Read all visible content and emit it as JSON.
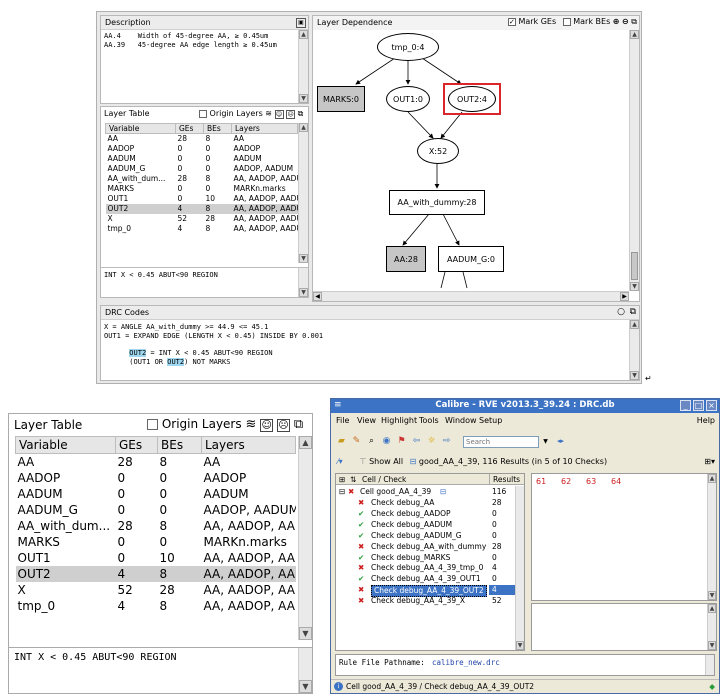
{
  "top": {
    "description": {
      "title": "Description",
      "lines": [
        "AA.4    Width of 45-degree AA, ≥ 0.45um",
        "AA.39   45-degree AA edge length ≥ 0.45um"
      ]
    },
    "layer_table": {
      "title": "Layer Table",
      "origin_layers": "Origin Layers",
      "columns": [
        "Variable",
        "GEs",
        "BEs",
        "Layers"
      ],
      "rows": [
        [
          "AA",
          "28",
          "8",
          "AA"
        ],
        [
          "AADOP",
          "0",
          "0",
          "AADOP"
        ],
        [
          "AADUM",
          "0",
          "0",
          "AADUM"
        ],
        [
          "AADUM_G",
          "0",
          "0",
          "AADOP, AADUM"
        ],
        [
          "AA_with_dum...",
          "28",
          "8",
          "AA, AADOP, AADU"
        ],
        [
          "MARKS",
          "0",
          "0",
          "MARKn.marks"
        ],
        [
          "OUT1",
          "0",
          "10",
          "AA, AADOP, AADU"
        ],
        [
          "OUT2",
          "4",
          "8",
          "AA, AADOP, AADU"
        ],
        [
          "X",
          "52",
          "28",
          "AA, AADOP, AADU"
        ],
        [
          "tmp_0",
          "4",
          "8",
          "AA, AADOP, AADU"
        ]
      ],
      "selected_row": 7,
      "expression": "INT X < 0.45 ABUT<90 REGION"
    },
    "layer_dependence": {
      "title": "Layer Dependence",
      "mark_ges": "Mark GEs",
      "mark_bes": "Mark BEs",
      "nodes": {
        "tmp0": "tmp_0:4",
        "marks": "MARKS:0",
        "out1": "OUT1:0",
        "out2": "OUT2:4",
        "x": "X:52",
        "aawd": "AA_with_dummy:28",
        "aa": "AA:28",
        "aadumg": "AADUM_G:0"
      }
    },
    "drc_codes": {
      "title": "DRC Codes",
      "line1": "X = ANGLE AA_with_dummy >= 44.9 <= 45.1",
      "line2": "OUT1 = EXPAND EDGE (LENGTH X < 0.45) INSIDE BY 0.001",
      "line3_hl": "OUT2",
      "line3_rest": " = INT X < 0.45 ABUT<90 REGION",
      "line4_a": "(OUT1 OR ",
      "line4_hl": "OUT2",
      "line4_b": ") NOT MARKS"
    }
  },
  "zoom_table": {
    "title": "Layer Table",
    "origin_layers": "Origin Layers",
    "columns": [
      "Variable",
      "GEs",
      "BEs",
      "Layers"
    ],
    "rows": [
      [
        "AA",
        "28",
        "8",
        "AA"
      ],
      [
        "AADOP",
        "0",
        "0",
        "AADOP"
      ],
      [
        "AADUM",
        "0",
        "0",
        "AADUM"
      ],
      [
        "AADUM_G",
        "0",
        "0",
        "AADOP, AADUM"
      ],
      [
        "AA_with_dum...",
        "28",
        "8",
        "AA, AADOP, AADU"
      ],
      [
        "MARKS",
        "0",
        "0",
        "MARKn.marks"
      ],
      [
        "OUT1",
        "0",
        "10",
        "AA, AADOP, AADU"
      ],
      [
        "OUT2",
        "4",
        "8",
        "AA, AADOP, AADU"
      ],
      [
        "X",
        "52",
        "28",
        "AA, AADOP, AADU"
      ],
      [
        "tmp_0",
        "4",
        "8",
        "AA, AADOP, AADU"
      ]
    ],
    "selected_row": 7,
    "expression": "INT X < 0.45 ABUT<90 REGION"
  },
  "rve": {
    "title": "Calibre - RVE v2013.3_39.24 : DRC.db",
    "menu": [
      "File",
      "View",
      "Highlight",
      "Tools",
      "Window",
      "Setup"
    ],
    "help": "Help",
    "search_placeholder": "Search",
    "show_all": "Show All",
    "cell_summary": "good_AA_4_39, 116 Results (in 5 of 10 Checks)",
    "col_check": "Cell / Check",
    "col_results": "Results",
    "cell_row": {
      "label": "Cell good_AA_4_39",
      "results": "116"
    },
    "checks": [
      {
        "label": "Check debug_AA",
        "results": "28",
        "status": "bad"
      },
      {
        "label": "Check debug_AADOP",
        "results": "0",
        "status": "ok"
      },
      {
        "label": "Check debug_AADUM",
        "results": "0",
        "status": "ok"
      },
      {
        "label": "Check debug_AADUM_G",
        "results": "0",
        "status": "ok"
      },
      {
        "label": "Check debug_AA_with_dummy",
        "results": "28",
        "status": "bad"
      },
      {
        "label": "Check debug_MARKS",
        "results": "0",
        "status": "ok"
      },
      {
        "label": "Check debug_AA_4_39_tmp_0",
        "results": "4",
        "status": "bad"
      },
      {
        "label": "Check debug_AA_4_39_OUT1",
        "results": "0",
        "status": "ok"
      },
      {
        "label": "Check debug_AA_4_39_OUT2",
        "results": "4",
        "status": "bad"
      },
      {
        "label": "Check debug_AA_4_39_X",
        "results": "52",
        "status": "bad"
      }
    ],
    "selected_check": 8,
    "result_numbers": [
      "61",
      "62",
      "63",
      "64"
    ],
    "rule_file_label": "Rule File Pathname:",
    "rule_file": "calibre_new.drc",
    "status": "Cell good_AA_4_39 / Check debug_AA_4_39_OUT2"
  },
  "colors": {
    "accent_blue": "#3c73c4",
    "red": "#cc1f1f",
    "green": "#2a9d3a",
    "highlight": "#9fd7f0"
  }
}
